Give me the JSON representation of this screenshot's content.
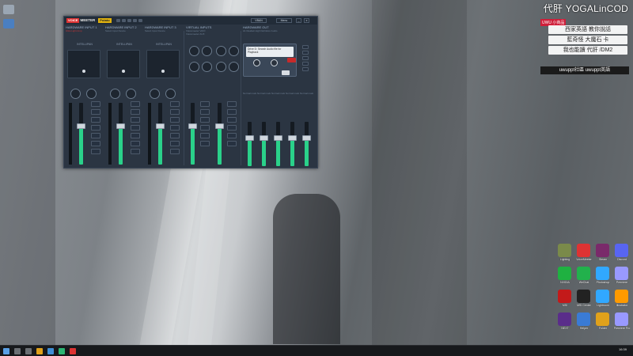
{
  "overlay": {
    "brand": "代肝 YOGALinCOD",
    "promo": {
      "tag": "UWU 小商品",
      "lines": [
        "西家英語 教你說話",
        "藍奇怪 大魔石 卡",
        "我也能讀 代肝 /DM2"
      ],
      "bar": "uwuppt社區   uwuppt英語"
    }
  },
  "voicemeeter": {
    "title_voice": "VOICE",
    "title_meeter": "MEETER",
    "title_edition": "Potato",
    "vban_label": "VBAN",
    "menu_label": "Menu",
    "minimize": "_",
    "close": "x",
    "strips": [
      {
        "title": "HARDWARE INPUT 1",
        "sub": "Ultra Light Amp",
        "label": "INTELLIPAN"
      },
      {
        "title": "HARDWARE INPUT 2",
        "sub": "Select Input Device",
        "label": "INTELLIPAN"
      },
      {
        "title": "HARDWARE INPUT 3",
        "sub": "Select Input Device",
        "label": "INTELLIPAN"
      }
    ],
    "virtual_inputs": {
      "title": "VIRTUAL INPUTS",
      "sub1": "Voicemeeter VAIO",
      "sub2": "Voicemeeter AUX"
    },
    "hardware_out": {
      "title": "HARDWARE OUT",
      "sub": "A1 Realtek High Definition Audio"
    },
    "cassette_label": "Drive D: Search Audio file for Playback",
    "bus_labels": [
      "Normal mode",
      "Normal mode",
      "Normal mode",
      "Normal mode",
      "Normal mode",
      "Normal mode"
    ],
    "fader_levels": [
      0.55,
      0.55,
      0.55,
      0.55,
      0.55,
      0.55,
      0.55,
      0.55,
      0.55,
      0.55
    ]
  },
  "desktop_icons_right": [
    "Lighting",
    "VoiceMeeter",
    "Steam",
    "Discord",
    "Pipe",
    "NVIDIA",
    "WeChat",
    "Photoshop",
    "Premiere",
    "OBS",
    "MSI",
    "MSI Center",
    "Lightroom",
    "Illustrator",
    "Resolve",
    "NEXT",
    "Helper",
    "Folder",
    "Premiere Pro",
    "Steam"
  ],
  "taskbar": {
    "time": "16:39",
    "date": "2023/9/2"
  },
  "colors": {
    "accent_green": "#2ad18a",
    "panel_bg": "#2b3542",
    "voice_red": "#d33333",
    "potato_yellow": "#e0b20f"
  }
}
